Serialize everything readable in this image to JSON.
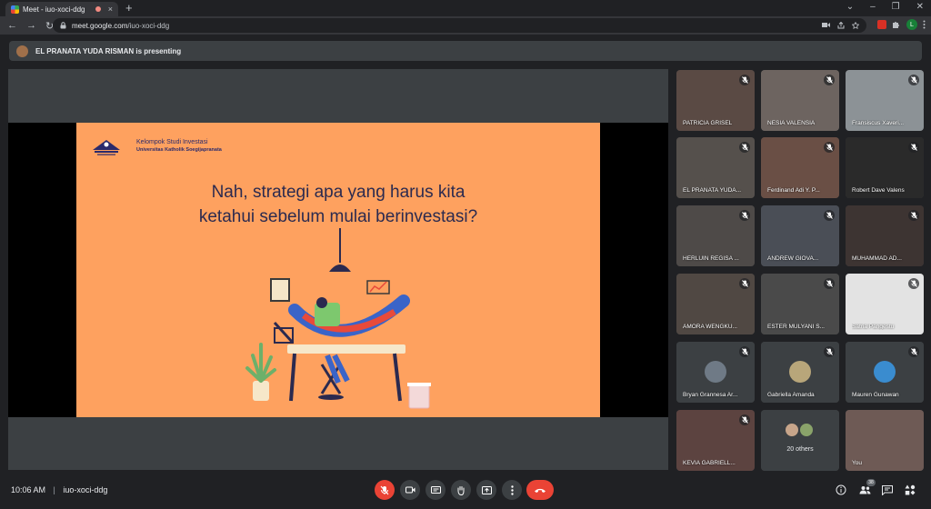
{
  "browser": {
    "tab_title": "Meet - iuo-xoci-ddg",
    "new_tab_symbol": "+",
    "close_symbol": "×",
    "window_controls": [
      "⌄",
      "–",
      "❐",
      "✕"
    ],
    "nav": [
      "←",
      "→",
      "↻"
    ],
    "url_host": "meet.google.com",
    "url_path": "/iuo-xoci-ddg",
    "profile_initial": "L"
  },
  "presenting_text": "EL PRANATA YUDA RISMAN is presenting",
  "slide": {
    "org_name": "Kelompok Studi Investasi",
    "org_sub": "Universitas Katholik Soegijapranata",
    "question_line1": "Nah, strategi apa yang harus kita",
    "question_line2": "ketahui sebelum mulai berinvestasi?"
  },
  "participants": [
    {
      "name": "PATRICIA GRISEL",
      "bg": "#5a4a44"
    },
    {
      "name": "NESIA VALENSIA",
      "bg": "#6d6460"
    },
    {
      "name": "Fransiscus Xaveri...",
      "bg": "#8c9296"
    },
    {
      "name": "EL PRANATA YUDA...",
      "bg": "#55504c"
    },
    {
      "name": "Ferdinand Adi Y. P...",
      "bg": "#6a4f45"
    },
    {
      "name": "Robert Dave Valens",
      "bg": "#2a2a2a"
    },
    {
      "name": "HERLUIN REGISA ...",
      "bg": "#4e4a48"
    },
    {
      "name": "ANDREW GIOVA...",
      "bg": "#4a4e56"
    },
    {
      "name": "MUHAMMAD AD...",
      "bg": "#3d3432"
    },
    {
      "name": "AMORA WENGKU...",
      "bg": "#504843"
    },
    {
      "name": "ESTER MULYANI S...",
      "bg": "#4a4a4a"
    },
    {
      "name": "Satria Pangestu",
      "bg": "#e3e3e3"
    },
    {
      "name": "Bryan Grannesa Ar...",
      "bg": "#3c4043",
      "avatar": "#6f7a86"
    },
    {
      "name": "Gabriella Amanda",
      "bg": "#3c4043",
      "avatar": "#b8a67a"
    },
    {
      "name": "Mauren Gunawan",
      "bg": "#3c4043",
      "avatar": "#3a8ccf"
    },
    {
      "name": "KEVIA GABRIELL...",
      "bg": "#5c4340"
    },
    {
      "name": "20 others",
      "bg": "#3c4043"
    },
    {
      "name": "You",
      "bg": "#6e5a55"
    }
  ],
  "bottom": {
    "time": "10:06 AM",
    "separator": "|",
    "meeting_code": "iuo-xoci-ddg",
    "people_count": "38"
  },
  "colors": {
    "slide_bg": "#fea15f",
    "end_call": "#ea4335",
    "panel": "#3c4043"
  }
}
